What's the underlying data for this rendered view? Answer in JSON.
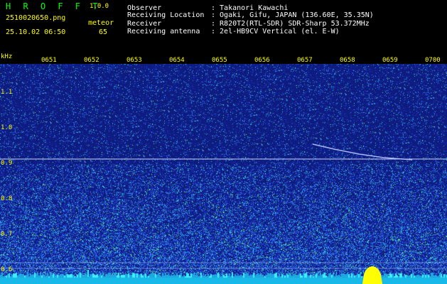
{
  "header": {
    "app_title": "H R O F F T",
    "app_version": "1.0.0",
    "file_name": "2510020650.png",
    "date_time": "25.10.02 06:50",
    "count_label": "meteor",
    "count_value": "65"
  },
  "info": [
    {
      "label": "Observer",
      "value": ": Takanori Kawachi"
    },
    {
      "label": "Receiving Location",
      "value": ": Ogaki, Gifu, JAPAN (136.60E, 35.35N)"
    },
    {
      "label": "Receiver",
      "value": ": R820T2(RTL-SDR) SDR-Sharp 53.372MHz"
    },
    {
      "label": "Receiving antenna",
      "value": ": 2el-HB9CV Vertical (el. E-W)"
    }
  ],
  "axes": {
    "unit": "kHz",
    "y_ticks": [
      "1.1",
      "1.0",
      "0.9",
      "0.8",
      "0.7",
      "0.6"
    ],
    "x_ticks": [
      "0651",
      "0652",
      "0653",
      "0654",
      "0655",
      "0656",
      "0657",
      "0658",
      "0659",
      "0700"
    ]
  },
  "colors": {
    "background": "#000000",
    "spectrogram_base": "#1a2a8c",
    "axis_text": "#ffff00",
    "title_text": "#00ff00",
    "info_text": "#ffffff",
    "noise_band": "#00ffff",
    "meteor_echo": "#ffff00"
  }
}
